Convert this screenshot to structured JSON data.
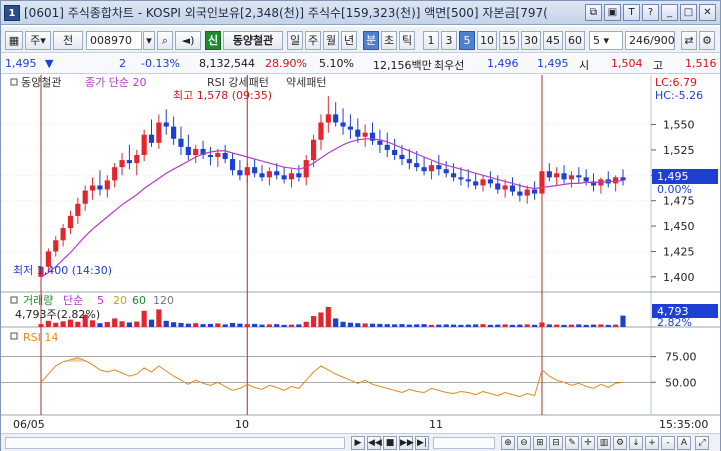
{
  "window": {
    "icon_label": "1",
    "title": "[0601] 주식종합차트 - KOSPI 외국인보유[2,348(천)] 주식수[159,323(천)] 액면[500] 자본금[797("
  },
  "toolbar": {
    "market_code": "주",
    "prev_label": "전",
    "stock_code": "008970",
    "stock_tag": "신",
    "stock_name": "동양철관",
    "period_day": "일",
    "period_week": "주",
    "period_month": "월",
    "period_year": "년",
    "period_minute": "분",
    "period_second": "초",
    "period_tick": "틱",
    "intervals": [
      "1",
      "3",
      "5",
      "10",
      "15",
      "30",
      "45",
      "60"
    ],
    "selected_interval": "5",
    "interval_select": "5",
    "count_display": "246/900"
  },
  "quote": {
    "price": "1,495",
    "change_arrow": "▼",
    "change": "2",
    "change_pct": "-0.13%",
    "volume": "8,132,544",
    "volume_ratio": "28.90%",
    "turnover_pct": "5.10%",
    "trade_value": "12,156백만",
    "priority_label": "최우선",
    "bid_price": "1,496",
    "ask_price": "1,495",
    "open_label": "시",
    "open_price": "1,504",
    "high_label": "고",
    "high_price": "1,516"
  },
  "price_panel": {
    "legend_stock": "동양철관",
    "legend_ma": "종가 단순 20",
    "legend_rsi_pattern": "RSI 강세패턴",
    "legend_weak_pattern": "약세패턴",
    "lc_label": "LC:6.79",
    "hc_label": "HC:-5.26",
    "max_annotation": "최고 1,578 (09:35)",
    "min_annotation": "최저 1,400 (14:30)",
    "current_price_tag": "1,495",
    "current_pct_tag": "0.00%",
    "y_ticks": [
      "1,550",
      "1,525",
      "1,500",
      "1,475",
      "1,450",
      "1,425",
      "1,400"
    ]
  },
  "volume_panel": {
    "legend_title": "거래량",
    "legend_simple": "단순",
    "legend_periods": [
      "5",
      "20",
      "60",
      "120"
    ],
    "current_value_text": "4,793주(2.82%)",
    "tag_value": "4,793",
    "tag_pct": "2.82%"
  },
  "rsi_panel": {
    "legend": "RSI 14",
    "y_ticks": [
      "75.00",
      "50.00"
    ]
  },
  "time_axis": {
    "labels": [
      "06/05",
      "10",
      "11"
    ],
    "right_label": "15:35:00"
  },
  "colors": {
    "up_candle": "#e3262d",
    "down_candle": "#1d3fd2",
    "ma_line": "#b23ec6",
    "rsi_line": "#e18a1d",
    "vertical_marker": "#a9302a",
    "tag_blue": "#1d3fd2"
  },
  "chart_data": {
    "type": "candlestick",
    "ohlc": [
      [
        1400,
        1412,
        1398,
        1410
      ],
      [
        1410,
        1428,
        1406,
        1425
      ],
      [
        1425,
        1440,
        1420,
        1436
      ],
      [
        1436,
        1452,
        1430,
        1448
      ],
      [
        1448,
        1465,
        1442,
        1460
      ],
      [
        1460,
        1478,
        1452,
        1472
      ],
      [
        1472,
        1490,
        1465,
        1485
      ],
      [
        1485,
        1498,
        1476,
        1490
      ],
      [
        1490,
        1505,
        1480,
        1486
      ],
      [
        1486,
        1500,
        1478,
        1495
      ],
      [
        1495,
        1512,
        1488,
        1508
      ],
      [
        1508,
        1522,
        1500,
        1515
      ],
      [
        1515,
        1530,
        1506,
        1512
      ],
      [
        1512,
        1525,
        1500,
        1520
      ],
      [
        1520,
        1545,
        1514,
        1540
      ],
      [
        1540,
        1555,
        1528,
        1532
      ],
      [
        1532,
        1560,
        1526,
        1552
      ],
      [
        1552,
        1565,
        1540,
        1548
      ],
      [
        1548,
        1558,
        1530,
        1536
      ],
      [
        1536,
        1548,
        1520,
        1528
      ],
      [
        1528,
        1540,
        1515,
        1520
      ],
      [
        1520,
        1530,
        1512,
        1526
      ],
      [
        1526,
        1534,
        1516,
        1520
      ],
      [
        1520,
        1528,
        1510,
        1518
      ],
      [
        1518,
        1526,
        1508,
        1522
      ],
      [
        1522,
        1530,
        1512,
        1516
      ],
      [
        1516,
        1522,
        1500,
        1505
      ],
      [
        1505,
        1515,
        1495,
        1500
      ],
      [
        1500,
        1512,
        1492,
        1508
      ],
      [
        1508,
        1516,
        1498,
        1502
      ],
      [
        1502,
        1510,
        1494,
        1498
      ],
      [
        1498,
        1508,
        1490,
        1504
      ],
      [
        1504,
        1512,
        1496,
        1500
      ],
      [
        1500,
        1508,
        1492,
        1496
      ],
      [
        1496,
        1506,
        1488,
        1502
      ],
      [
        1502,
        1510,
        1494,
        1498
      ],
      [
        1498,
        1520,
        1490,
        1515
      ],
      [
        1515,
        1540,
        1508,
        1535
      ],
      [
        1535,
        1560,
        1525,
        1552
      ],
      [
        1552,
        1578,
        1542,
        1560
      ],
      [
        1560,
        1572,
        1548,
        1552
      ],
      [
        1552,
        1566,
        1540,
        1548
      ],
      [
        1548,
        1560,
        1536,
        1545
      ],
      [
        1545,
        1556,
        1532,
        1538
      ],
      [
        1538,
        1550,
        1528,
        1542
      ],
      [
        1542,
        1552,
        1530,
        1534
      ],
      [
        1534,
        1545,
        1522,
        1530
      ],
      [
        1530,
        1542,
        1518,
        1525
      ],
      [
        1525,
        1536,
        1515,
        1520
      ],
      [
        1520,
        1530,
        1510,
        1516
      ],
      [
        1516,
        1526,
        1506,
        1512
      ],
      [
        1512,
        1524,
        1504,
        1508
      ],
      [
        1508,
        1518,
        1500,
        1504
      ],
      [
        1504,
        1514,
        1496,
        1510
      ],
      [
        1510,
        1520,
        1500,
        1506
      ],
      [
        1506,
        1514,
        1498,
        1502
      ],
      [
        1502,
        1512,
        1494,
        1498
      ],
      [
        1498,
        1508,
        1490,
        1496
      ],
      [
        1496,
        1506,
        1488,
        1494
      ],
      [
        1494,
        1502,
        1486,
        1490
      ],
      [
        1490,
        1500,
        1484,
        1496
      ],
      [
        1496,
        1504,
        1488,
        1492
      ],
      [
        1492,
        1500,
        1482,
        1486
      ],
      [
        1486,
        1496,
        1478,
        1490
      ],
      [
        1490,
        1498,
        1480,
        1484
      ],
      [
        1484,
        1492,
        1474,
        1480
      ],
      [
        1480,
        1490,
        1472,
        1486
      ],
      [
        1486,
        1494,
        1476,
        1482
      ],
      [
        1482,
        1510,
        1478,
        1504
      ],
      [
        1504,
        1512,
        1494,
        1498
      ],
      [
        1498,
        1508,
        1490,
        1502
      ],
      [
        1502,
        1510,
        1492,
        1496
      ],
      [
        1496,
        1504,
        1488,
        1500
      ],
      [
        1500,
        1508,
        1492,
        1498
      ],
      [
        1498,
        1506,
        1490,
        1494
      ],
      [
        1494,
        1502,
        1484,
        1490
      ],
      [
        1490,
        1498,
        1482,
        1496
      ],
      [
        1496,
        1504,
        1488,
        1492
      ],
      [
        1492,
        1500,
        1484,
        1498
      ],
      [
        1498,
        1506,
        1490,
        1495
      ]
    ],
    "ma20": [
      1400,
      1404,
      1410,
      1417,
      1424,
      1432,
      1440,
      1447,
      1453,
      1459,
      1465,
      1471,
      1476,
      1481,
      1487,
      1492,
      1497,
      1502,
      1506,
      1510,
      1514,
      1518,
      1521,
      1523,
      1524,
      1524,
      1522,
      1520,
      1518,
      1516,
      1514,
      1512,
      1510,
      1508,
      1507,
      1506,
      1508,
      1512,
      1517,
      1522,
      1526,
      1530,
      1533,
      1535,
      1536,
      1536,
      1535,
      1533,
      1530,
      1527,
      1524,
      1521,
      1518,
      1515,
      1512,
      1510,
      1508,
      1506,
      1504,
      1502,
      1500,
      1498,
      1496,
      1494,
      1492,
      1490,
      1488,
      1487,
      1488,
      1489,
      1490,
      1491,
      1492,
      1492,
      1493,
      1493,
      1493,
      1494,
      1494,
      1495
    ],
    "volume": [
      1200,
      2600,
      1800,
      2400,
      3100,
      2200,
      5200,
      2800,
      1600,
      2100,
      3600,
      2400,
      1900,
      2300,
      6800,
      3100,
      7400,
      2600,
      2000,
      1700,
      1400,
      1600,
      1200,
      1300,
      1500,
      1100,
      1700,
      1400,
      1200,
      1300,
      1000,
      1100,
      1200,
      900,
      1000,
      1100,
      2200,
      4600,
      6100,
      8400,
      3600,
      2200,
      1800,
      1600,
      1500,
      1400,
      1300,
      1200,
      1100,
      1200,
      1000,
      1100,
      1200,
      900,
      1000,
      1100,
      1000,
      900,
      1000,
      1100,
      1200,
      900,
      1000,
      1100,
      900,
      1000,
      1100,
      900,
      1900,
      1100,
      1000,
      900,
      1000,
      1100,
      900,
      1000,
      1100,
      900,
      1000,
      4793
    ],
    "rsi": [
      50,
      58,
      66,
      70,
      72,
      74,
      71,
      67,
      62,
      60,
      62,
      59,
      56,
      58,
      64,
      60,
      66,
      61,
      56,
      52,
      48,
      52,
      49,
      47,
      50,
      46,
      42,
      44,
      48,
      45,
      43,
      47,
      45,
      42,
      46,
      44,
      52,
      60,
      66,
      62,
      58,
      55,
      52,
      49,
      52,
      48,
      46,
      44,
      42,
      40,
      43,
      41,
      40,
      44,
      42,
      40,
      39,
      41,
      40,
      38,
      41,
      39,
      37,
      40,
      38,
      36,
      39,
      37,
      62,
      56,
      52,
      50,
      47,
      49,
      46,
      44,
      48,
      45,
      49,
      50
    ],
    "y_range": [
      1390,
      1585
    ],
    "rsi_range": [
      20,
      100
    ]
  }
}
